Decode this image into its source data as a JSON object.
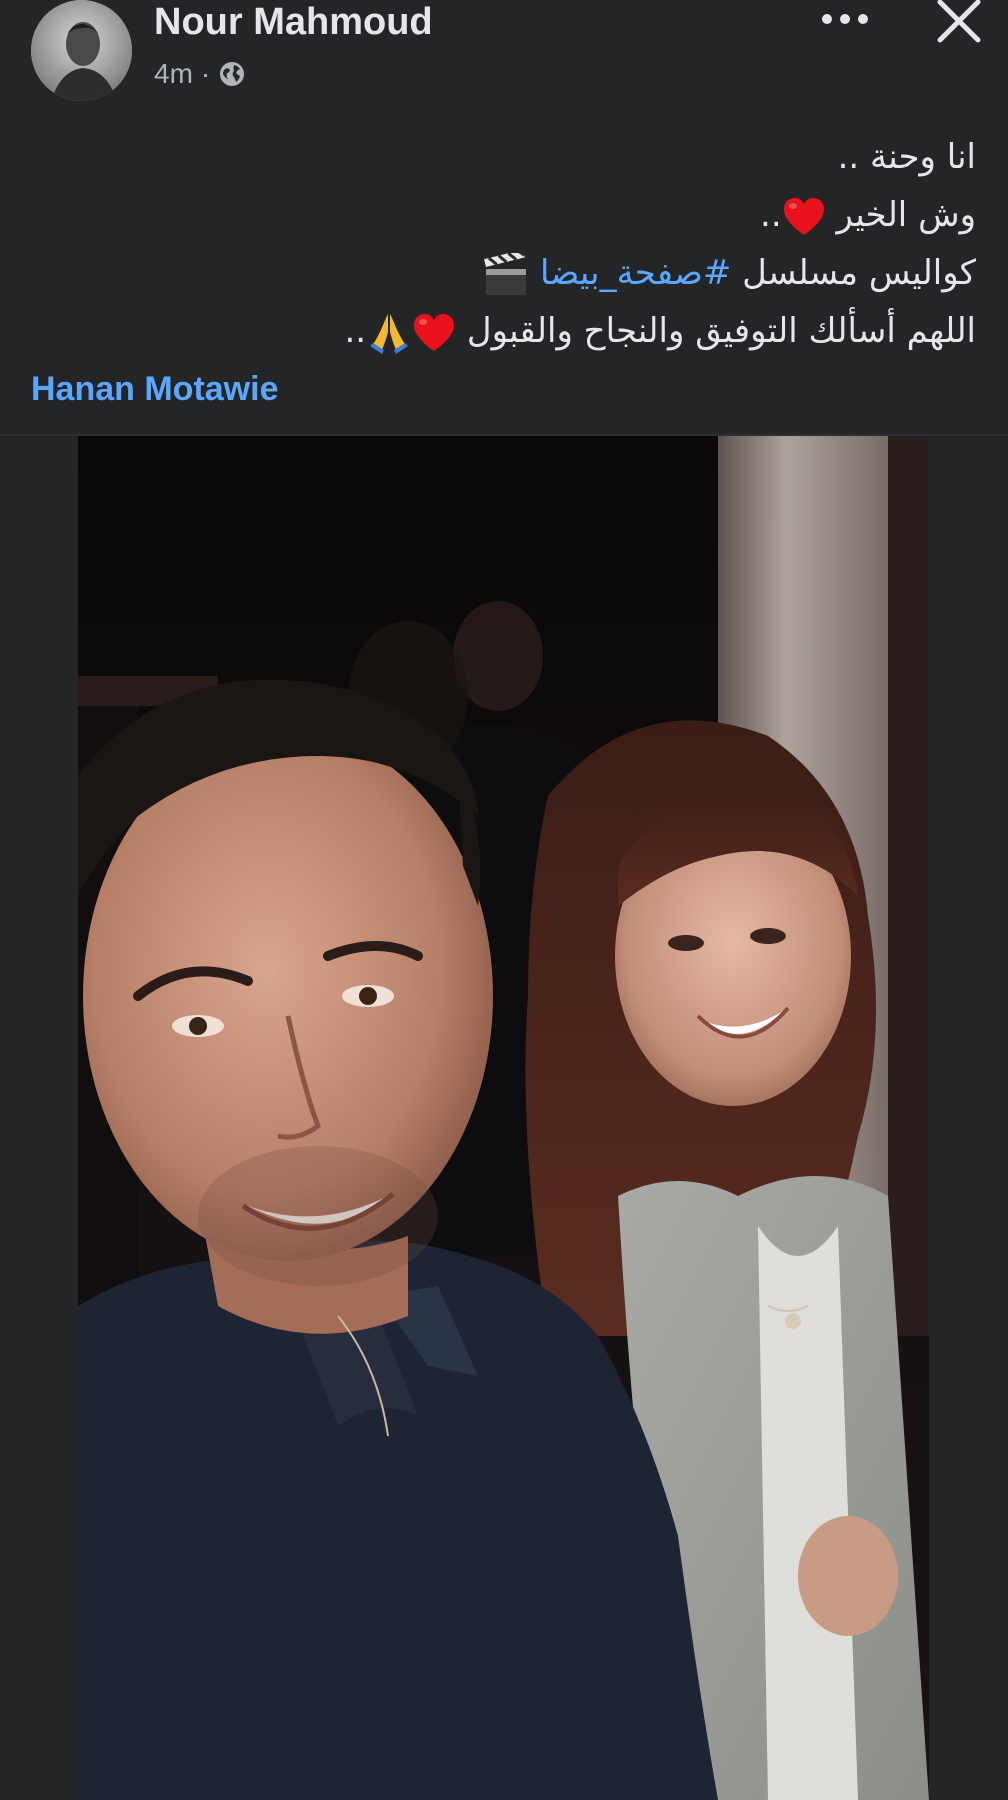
{
  "post": {
    "author_name": "Nour Mahmoud",
    "time_ago": "4m",
    "separator": "·",
    "privacy_icon": "globe-icon",
    "more_icon": "more-horizontal-icon",
    "close_icon": "close-icon",
    "text_lines": {
      "line1": "انا وحنة ..",
      "line2_text": "وش الخير",
      "line2_suffix": "..",
      "line3_text": "كواليس مسلسل ",
      "line3_hashtag": "#صفحة_بيضا",
      "line4_text": "اللهم أسألك التوفيق والنجاح والقبول",
      "line4_suffix": ".."
    },
    "tagged_person": "Hanan Motawie",
    "photo_alt": "Selfie of a man in a navy polo shirt and a smiling woman with brown hair on a film set",
    "colors": {
      "background": "#242526",
      "text": "#e4e6eb",
      "secondary_text": "#b0b3b8",
      "link": "#5aa7ff"
    }
  }
}
